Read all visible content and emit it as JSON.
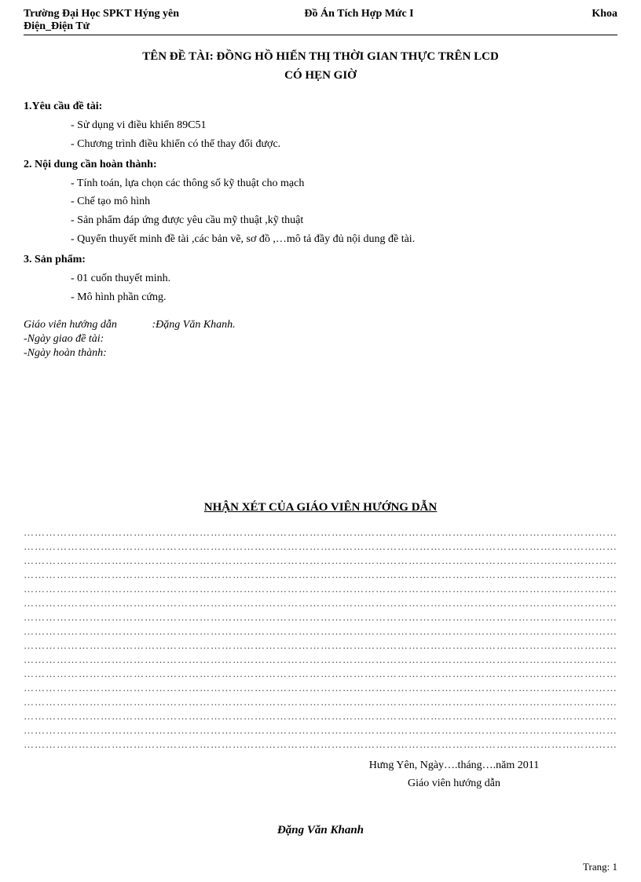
{
  "header": {
    "left_line1": "Trường Đại Học SPKT Hýng yên",
    "left_line2": "Điện_Điện Tử",
    "center": "Đồ Án Tích Hợp Mức I",
    "right": "Khoa"
  },
  "title": {
    "prefix": "TÊN ĐỀ TÀI:",
    "line1": "ĐỒNG HỒ HIỂN THỊ THỜI GIAN THỰC TRÊN LCD",
    "line2": "CÓ HẸN GIỜ"
  },
  "sections": {
    "s1": {
      "heading": "1.Yêu cầu đề tài:",
      "items": [
        "- Sử dụng vi điều khiển 89C51",
        "- Chương trình điều khiển có thể thay đổi được."
      ]
    },
    "s2": {
      "heading": "2. Nội dung cần hoàn thành:",
      "items": [
        "- Tính toán, lựa chọn các thông số kỹ thuật cho mạch",
        "- Chế tạo mô hình",
        "- Sản phẩm đáp ứng được yêu cầu mỹ thuật ,kỹ thuật",
        "- Quyển thuyết minh đề tài ,các bản vẽ, sơ đồ ,…mô tả đầy đủ nội dung đề tài."
      ]
    },
    "s3": {
      "heading": "3. Sản phẩm:",
      "items": [
        "- 01 cuốn thuyết minh.",
        "- Mô hình phần cứng."
      ]
    }
  },
  "info": {
    "supervisor_label": "Giáo viên hướng dẫn",
    "supervisor_value": ":Đặng Văn Khanh.",
    "assign_date_label": "-Ngày giao đề tài:",
    "complete_date_label": "-Ngày hoàn thành:"
  },
  "review": {
    "title": "NHẬN XÉT CỦA GIÁO VIÊN HƯỚNG DẪN",
    "line_count": 16
  },
  "sign": {
    "place_date": "Hưng Yên, Ngày….tháng….năm  2011",
    "role": "Giáo viên hướng dẫn",
    "name": "Đặng Văn Khanh"
  },
  "footer": {
    "page_label": "Trang:",
    "page_num": "1"
  }
}
